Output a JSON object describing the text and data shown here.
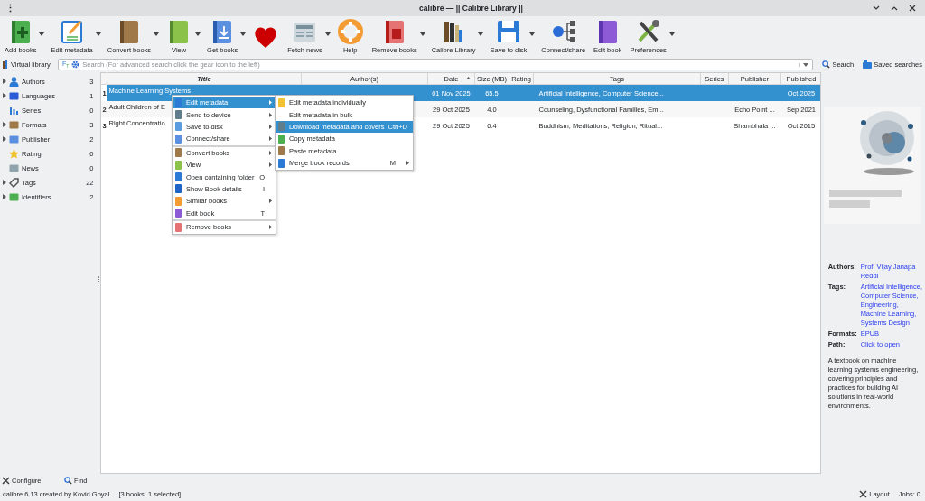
{
  "window": {
    "menu_glyph": "⋮",
    "title": "calibre — || Calibre Library ||"
  },
  "toolbar": [
    {
      "label": "Add books",
      "has_menu": true
    },
    {
      "label": "Edit metadata",
      "has_menu": true
    },
    {
      "label": "Convert books",
      "has_menu": true
    },
    {
      "label": "View",
      "has_menu": true
    },
    {
      "label": "Get books",
      "has_menu": true
    },
    {
      "has_menu": false
    },
    {
      "label": "Fetch news",
      "has_menu": true
    },
    {
      "label": "Help",
      "has_menu": false
    },
    {
      "label": "Remove books",
      "has_menu": true
    },
    {
      "label": "Calibre Library",
      "has_menu": true
    },
    {
      "label": "Save to disk",
      "has_menu": true
    },
    {
      "label": "Connect/share",
      "has_menu": false
    },
    {
      "label": "Edit book",
      "has_menu": false
    },
    {
      "label": "Preferences",
      "has_menu": true
    }
  ],
  "virtual_library": "Virtual library",
  "search": {
    "case_glyph": "F$_{T}$",
    "placeholder": "Search (For advanced search click the gear icon to the left)",
    "button": "Search",
    "saved": "Saved searches"
  },
  "sidebar": {
    "items": [
      {
        "label": "Authors",
        "count": "3",
        "expandable": true
      },
      {
        "label": "Languages",
        "count": "1",
        "expandable": true
      },
      {
        "label": "Series",
        "count": "0",
        "expandable": false
      },
      {
        "label": "Formats",
        "count": "3",
        "expandable": true
      },
      {
        "label": "Publisher",
        "count": "2",
        "expandable": true
      },
      {
        "label": "Rating",
        "count": "0",
        "expandable": false
      },
      {
        "label": "News",
        "count": "0",
        "expandable": false
      },
      {
        "label": "Tags",
        "count": "22",
        "expandable": true
      },
      {
        "label": "Identifiers",
        "count": "2",
        "expandable": true
      }
    ],
    "configure": "Configure",
    "find": "Find"
  },
  "table": {
    "columns": [
      {
        "label": "Title",
        "sorted": false
      },
      {
        "label": "Author(s)",
        "sorted": false
      },
      {
        "label": "Date",
        "sorted": true
      },
      {
        "label": "Size (MB)",
        "sorted": false
      },
      {
        "label": "Rating",
        "sorted": false
      },
      {
        "label": "Tags",
        "sorted": false
      },
      {
        "label": "Series",
        "sorted": false
      },
      {
        "label": "Publisher",
        "sorted": false
      },
      {
        "label": "Published",
        "sorted": false
      }
    ],
    "rows": [
      {
        "number": "1",
        "selected": true,
        "cells": [
          "Machine Learning Systems",
          "",
          "01 Nov 2025",
          "65.5",
          "",
          "Artificial Intelligence, Computer Science...",
          "",
          "",
          "Oct 2025"
        ]
      },
      {
        "number": "2",
        "selected": false,
        "cells": [
          "Adult Children of E",
          "",
          "29 Oct 2025",
          "4.0",
          "",
          "Counseling, Dysfunctional Families, Em...",
          "",
          "Echo Point ...",
          "Sep 2021"
        ]
      },
      {
        "number": "3",
        "selected": false,
        "cells": [
          "Right Concentratio",
          "",
          "29 Oct 2025",
          "0.4",
          "",
          "Buddhism, Meditations, Religion, Ritual...",
          "",
          "Shambhala ...",
          "Oct 2015"
        ]
      }
    ]
  },
  "context_menu": [
    {
      "label": "Edit metadata",
      "has_submenu": true,
      "selected": true,
      "separator_before": false
    },
    {
      "label": "Send to device",
      "has_submenu": true,
      "selected": false,
      "separator_before": false
    },
    {
      "label": "Save to disk",
      "has_submenu": true,
      "selected": false,
      "separator_before": false
    },
    {
      "label": "Connect/share",
      "has_submenu": true,
      "selected": false,
      "separator_before": false
    },
    {
      "label": "Convert books",
      "has_submenu": true,
      "selected": false,
      "separator_before": true
    },
    {
      "label": "View",
      "has_submenu": true,
      "selected": false,
      "separator_before": false
    },
    {
      "label": "Open containing folder",
      "shortcut": "O",
      "has_submenu": false,
      "selected": false,
      "separator_before": false
    },
    {
      "label": "Show Book details",
      "shortcut": "I",
      "has_submenu": false,
      "selected": false,
      "separator_before": false
    },
    {
      "label": "Similar books",
      "has_submenu": true,
      "selected": false,
      "separator_before": false
    },
    {
      "label": "Edit book",
      "shortcut": "T",
      "has_submenu": false,
      "selected": false,
      "separator_before": false
    },
    {
      "label": "Remove books",
      "has_submenu": true,
      "selected": false,
      "separator_before": true
    }
  ],
  "submenu": [
    {
      "label": "Edit metadata individually",
      "has_submenu": false,
      "selected": false
    },
    {
      "label": "Edit metadata in bulk",
      "has_submenu": false,
      "selected": false
    },
    {
      "label": "Download metadata and covers",
      "shortcut": "Ctrl+D",
      "has_submenu": false,
      "selected": true
    },
    {
      "label": "Copy metadata",
      "has_submenu": false,
      "selected": false
    },
    {
      "label": "Paste metadata",
      "has_submenu": false,
      "selected": false
    },
    {
      "label": "Merge book records",
      "shortcut": "M",
      "has_submenu": true,
      "selected": false
    }
  ],
  "details": {
    "fields": [
      {
        "label": "Authors:",
        "values": [
          "Prof. Vijay Janapa",
          "Reddi"
        ]
      },
      {
        "label": "Tags:",
        "values": [
          "Artificial Intelligence,",
          "Computer Science,",
          "Engineering,",
          "Machine Learning,",
          "Systems Design"
        ]
      },
      {
        "label": "Formats:",
        "values": [
          "EPUB"
        ]
      },
      {
        "label": "Path:",
        "values": [
          "Click to open"
        ]
      }
    ],
    "description": "A textbook on machine learning systems engineering, covering principles and practices for building AI solutions in real-world environments."
  },
  "status_bar": {
    "version": "calibre 6.13 created by Kovid Goyal",
    "selection": "[3 books, 1 selected]",
    "layout": "Layout",
    "jobs": "Jobs: 0"
  }
}
